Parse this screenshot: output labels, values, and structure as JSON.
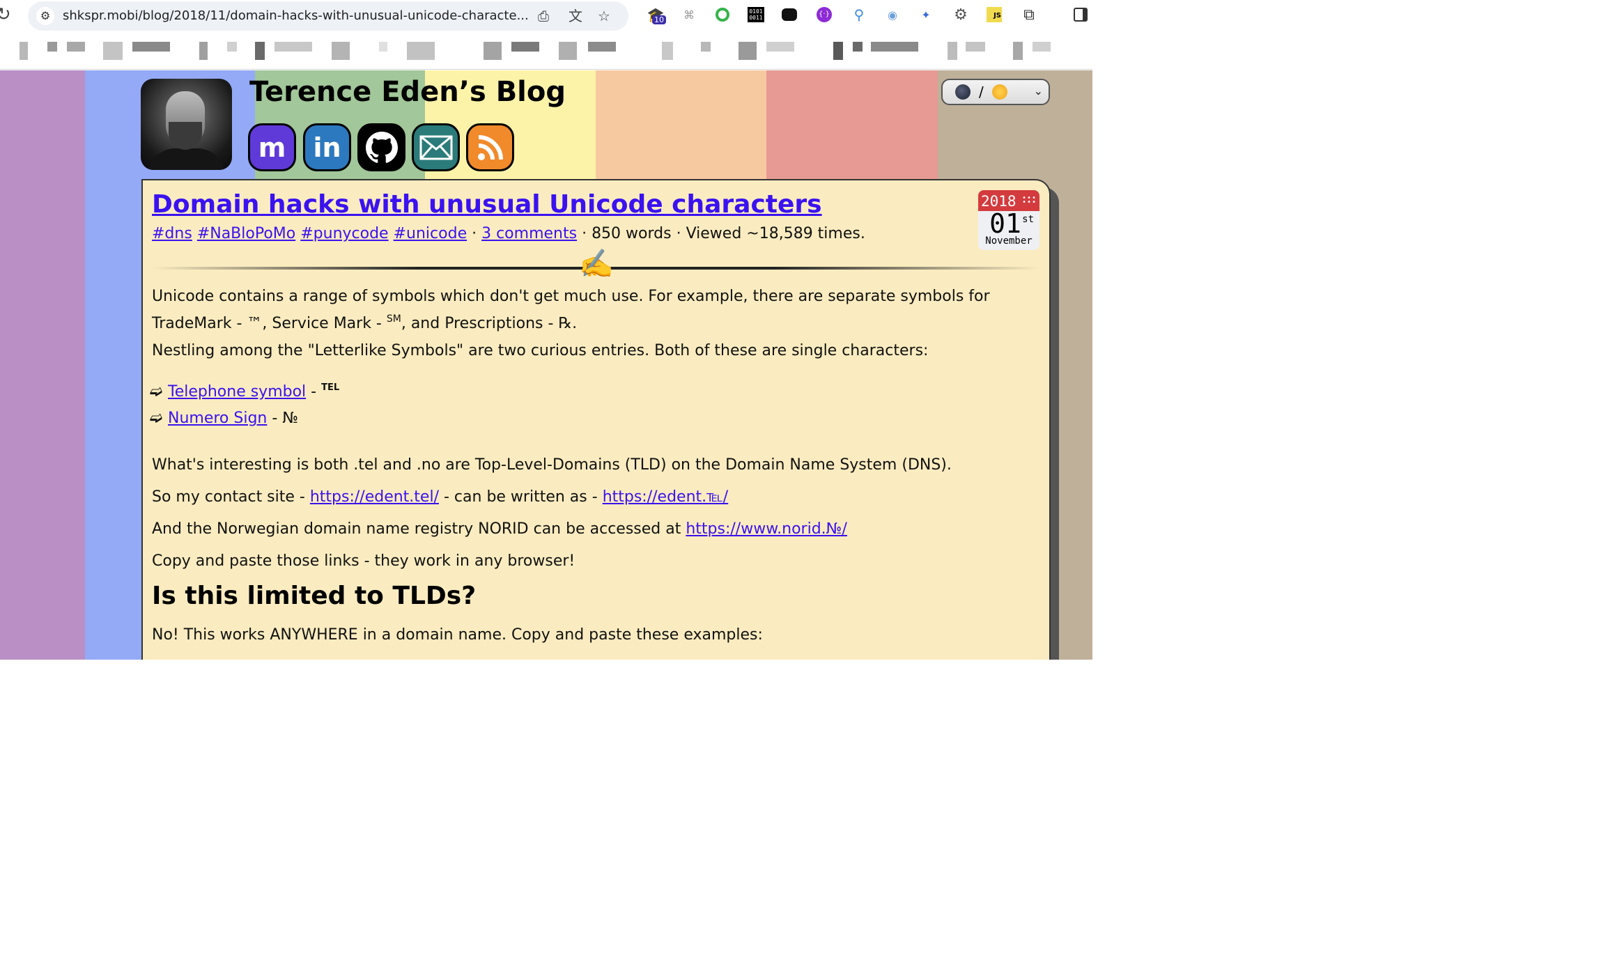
{
  "browser": {
    "url": "shkspr.mobi/blog/2018/11/domain-hacks-with-unusual-unicode-characte...",
    "extension_badge": "10"
  },
  "header": {
    "site_title": "Terence Eden’s Blog",
    "social_icons": [
      "mastodon-icon",
      "linkedin-icon",
      "github-icon",
      "email-icon",
      "rss-icon"
    ],
    "theme_separator": "/"
  },
  "article": {
    "title": "Domain hacks with unusual Unicode characters",
    "tags": [
      "#dns",
      "#NaBloPoMo",
      "#punycode",
      "#unicode"
    ],
    "comments": "3 comments",
    "words": "850 words",
    "views": "Viewed ~18,589 times.",
    "sep": " · ",
    "date": {
      "year": "2018",
      "day": "01",
      "suffix": "st",
      "month": "November"
    },
    "p1_a": "Unicode contains a range of symbols which don't get much use. For example, there are separate symbols for TradeMark - ™, Service Mark - ",
    "p1_sm": "SM",
    "p1_b": ", and Prescriptions - ℞.",
    "p2": "Nestling among the \"Letterlike Symbols\" are two curious entries. Both of these are single characters:",
    "list": [
      {
        "link": "Telephone symbol",
        "sep": " - ",
        "symbol": "TEL"
      },
      {
        "link": "Numero Sign",
        "sep": " - ",
        "symbol": "№"
      }
    ],
    "p3": "What's interesting is both .tel and .no are Top-Level-Domains (TLD) on the Domain Name System (DNS).",
    "p4_a": "So my contact site - ",
    "p4_link1": "https://edent.tel/",
    "p4_b": " - can be written as - ",
    "p4_link2": "https://edent.℡/",
    "p5_a": "And the Norwegian domain name registry NORID can be accessed at ",
    "p5_link": "https://www.norid.№/",
    "p6": "Copy and paste those links - they work in any browser!",
    "h2": "Is this limited to TLDs?",
    "p7": "No! This works ANYWHERE in a domain name. Copy and paste these examples:"
  },
  "colors": {
    "stripes": [
      "#b98fc6",
      "#94aaf7",
      "#a2c79a",
      "#fdf3a8",
      "#f6c9a0",
      "#e69a93",
      "#bfb09a"
    ],
    "link": "#3a12f0",
    "article_bg": "#faecc0",
    "mastodon": "#5f3ad8",
    "linkedin": "#2c79bf",
    "github": "#000000",
    "email": "#2b7b7a",
    "rss": "#f18a2a"
  }
}
